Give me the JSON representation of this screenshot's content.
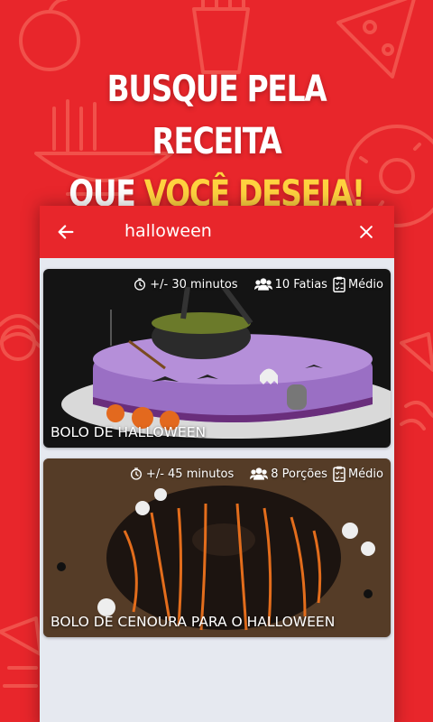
{
  "headline": {
    "line1": "BUSQUE PELA RECEITA",
    "line2_white": "QUE ",
    "line2_highlight": "VOCÊ DESEJA!"
  },
  "search": {
    "query": "halloween",
    "back_icon": "arrow-left-icon",
    "clear_icon": "close-icon"
  },
  "recipes": [
    {
      "title": "BOLO DE HALLOWEEN",
      "time": "+/- 30 minutos",
      "servings": "10 Fatias",
      "difficulty": "Médio"
    },
    {
      "title": "BOLO DE CENOURA PARA O HALLOWEEN",
      "time": "+/- 45 minutos",
      "servings": "8 Porções",
      "difficulty": "Médio"
    }
  ],
  "colors": {
    "brand_red": "#e8262b",
    "highlight_yellow": "#ffd23f",
    "list_background": "#e6e9f0"
  }
}
